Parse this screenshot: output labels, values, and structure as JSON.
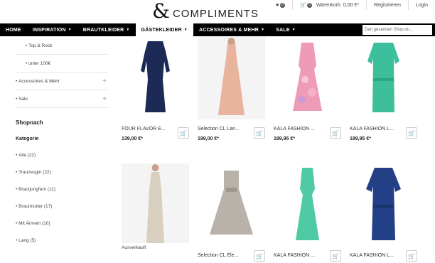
{
  "header": {
    "logo_amp": "&",
    "logo_text": "COMPLIMENTS",
    "wishlist_count": "0",
    "cart_count": "0",
    "cart_label": "Warenkorb",
    "cart_total": "0,00 €*",
    "register_label": "Registrieren",
    "login_label": "Login"
  },
  "nav": {
    "items": [
      {
        "label": "HOME"
      },
      {
        "label": "INSPIRATION"
      },
      {
        "label": "BRAUTKLEIDER"
      },
      {
        "label": "GÄSTEKLEIDER"
      },
      {
        "label": "ACCESSOIRES & MEHR"
      },
      {
        "label": "SALE"
      }
    ],
    "search_placeholder": "Den gesamten Shop du..."
  },
  "sidebar": {
    "sub_items": [
      {
        "label": "Top & Rock"
      },
      {
        "label": "unter 100€"
      }
    ],
    "sections": [
      {
        "label": "Accessoires & Mehr"
      },
      {
        "label": "Sale"
      }
    ],
    "shop_heading": "Shopnach",
    "category_heading": "Kategorie",
    "categories": [
      {
        "label": "Alle (22)"
      },
      {
        "label": "Trauzeugin (22)"
      },
      {
        "label": "Brautjungfern (11)"
      },
      {
        "label": "Brautmutter (17)"
      },
      {
        "label": "Mit Ärmeln (10)"
      },
      {
        "label": "Lang (5)"
      }
    ]
  },
  "products": [
    {
      "name": "FOUR FLAVOR E...",
      "price": "139,00 €*",
      "color": "#1d2a55"
    },
    {
      "name": "Selection CL Lan...",
      "price": "199,00 €*",
      "color": "#e9b49d"
    },
    {
      "name": "KALA FASHION ...",
      "price": "199,95 €*",
      "color": "#ee9bb8"
    },
    {
      "name": "KALA FASHION L...",
      "price": "189,95 €*",
      "color": "#3ebf9c"
    },
    {
      "name": "",
      "price": "",
      "note": "Ausverkauft",
      "color": "#d9cfc0"
    },
    {
      "name": "Selection CL Ele...",
      "price": "",
      "color": "#b9b2aa"
    },
    {
      "name": "KALA FASHION ...",
      "price": "",
      "color": "#4fcaa4"
    },
    {
      "name": "KALA FASHION L...",
      "price": "",
      "color": "#233f86"
    }
  ]
}
